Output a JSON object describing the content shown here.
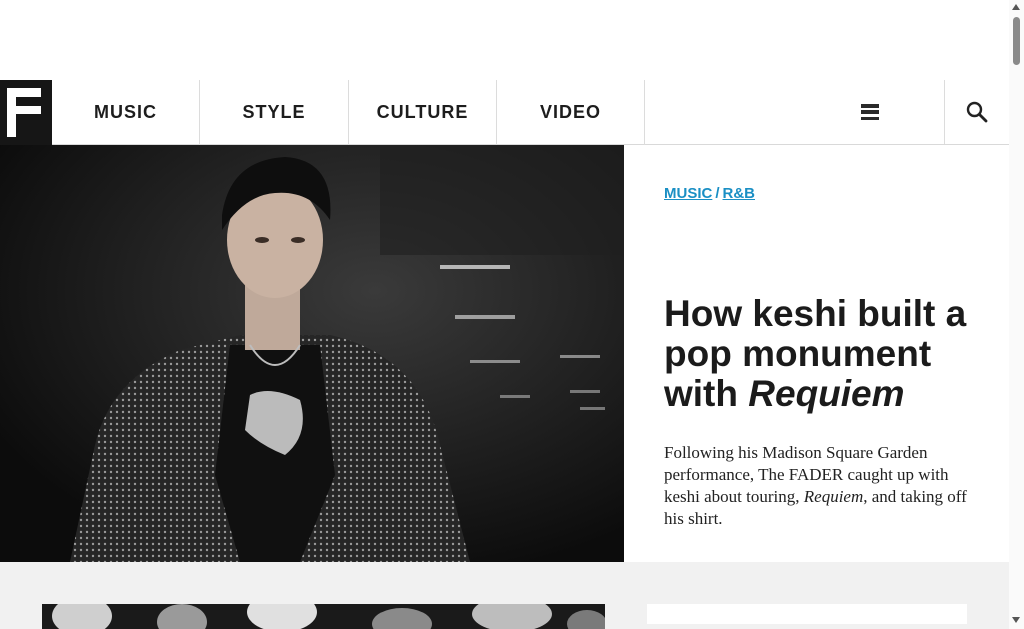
{
  "brand": {
    "logo_letter": "F"
  },
  "nav": {
    "items": [
      {
        "label": "MUSIC"
      },
      {
        "label": "STYLE"
      },
      {
        "label": "CULTURE"
      },
      {
        "label": "VIDEO"
      }
    ],
    "menu_icon": "hamburger-menu-icon",
    "search_icon": "search-icon"
  },
  "hero": {
    "breadcrumbs": [
      {
        "label": "MUSIC"
      },
      {
        "label": "R&B"
      }
    ],
    "breadcrumb_separator": "/",
    "headline_prefix": "How keshi built a pop monument with ",
    "headline_italic": "Requiem",
    "dek_prefix": "Following his Madison Square Garden performance, The FADER caught up with keshi about touring, ",
    "dek_italic": "Requiem",
    "dek_suffix": ", and taking off his shirt.",
    "image_subject": "portrait of keshi in studded leather jacket"
  },
  "colors": {
    "accent_link": "#1a8fc4",
    "nav_text": "#1d1d1d",
    "logo_bg": "#161616",
    "section_bg": "#f1f1f1"
  }
}
